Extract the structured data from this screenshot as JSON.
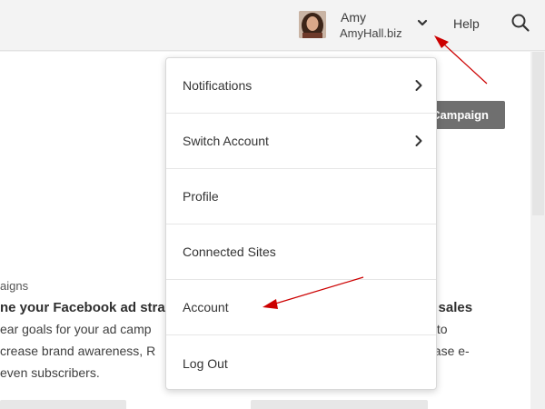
{
  "header": {
    "user_name": "Amy",
    "user_site": "AmyHall.biz",
    "help_label": "Help",
    "icons": {
      "avatar": "user-avatar",
      "dropdown": "chevron-down-icon",
      "search": "search-icon"
    }
  },
  "content": {
    "campaign_button_label": "Campaign",
    "section_label": "aigns",
    "card_left_title": "ne your Facebook ad strat",
    "card_right_title": "e sales",
    "card_left_lines": [
      "ear goals for your ad camp",
      "crease brand awareness, R",
      "even subscribers."
    ],
    "card_right_lines": [
      "s to",
      "ease e-"
    ]
  },
  "menu": {
    "items": [
      {
        "label": "Notifications",
        "has_submenu": true
      },
      {
        "label": "Switch Account",
        "has_submenu": true
      },
      {
        "label": "Profile",
        "has_submenu": false
      },
      {
        "label": "Connected Sites",
        "has_submenu": false
      },
      {
        "label": "Account",
        "has_submenu": false
      },
      {
        "label": "Log Out",
        "has_submenu": false
      }
    ]
  },
  "colors": {
    "annotation": "#cc0000",
    "button_dark": "#6f6f6f"
  }
}
